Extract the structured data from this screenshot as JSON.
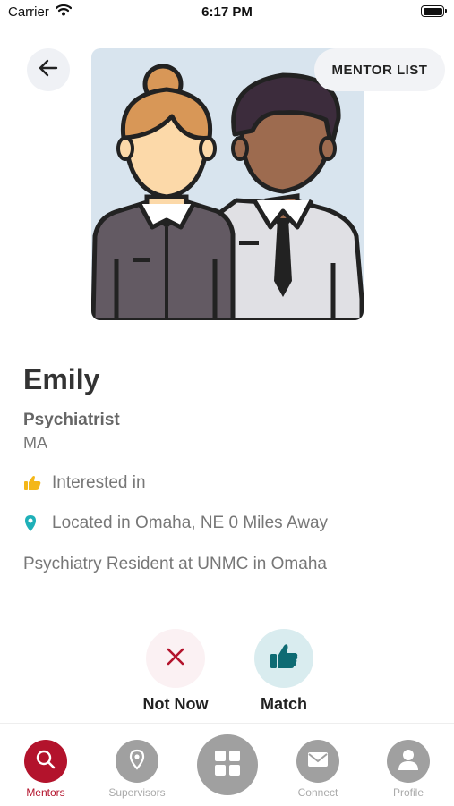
{
  "status_bar": {
    "carrier": "Carrier",
    "time": "6:17 PM"
  },
  "header": {
    "mentor_list_label": "MENTOR LIST"
  },
  "profile": {
    "name": "Emily",
    "role": "Psychiatrist",
    "degree": "MA",
    "interested_label": "Interested in",
    "location": "Located in Omaha, NE 0 Miles Away",
    "bio": "Psychiatry Resident at UNMC in Omaha"
  },
  "actions": {
    "not_now_label": "Not Now",
    "match_label": "Match"
  },
  "nav": {
    "items": [
      {
        "label": "Mentors",
        "icon": "search-icon",
        "active": true
      },
      {
        "label": "Supervisors",
        "icon": "location-pin-icon",
        "active": false
      },
      {
        "label": "",
        "icon": "grid-icon",
        "active": false
      },
      {
        "label": "Connect",
        "icon": "mail-icon",
        "active": false
      },
      {
        "label": "Profile",
        "icon": "person-icon",
        "active": false
      }
    ]
  },
  "colors": {
    "accent": "#b3132c",
    "match": "#0e6b73",
    "thumb_icon": "#f4b71a",
    "pin_icon": "#1fb0b8",
    "nav_inactive": "#a0a0a0"
  }
}
